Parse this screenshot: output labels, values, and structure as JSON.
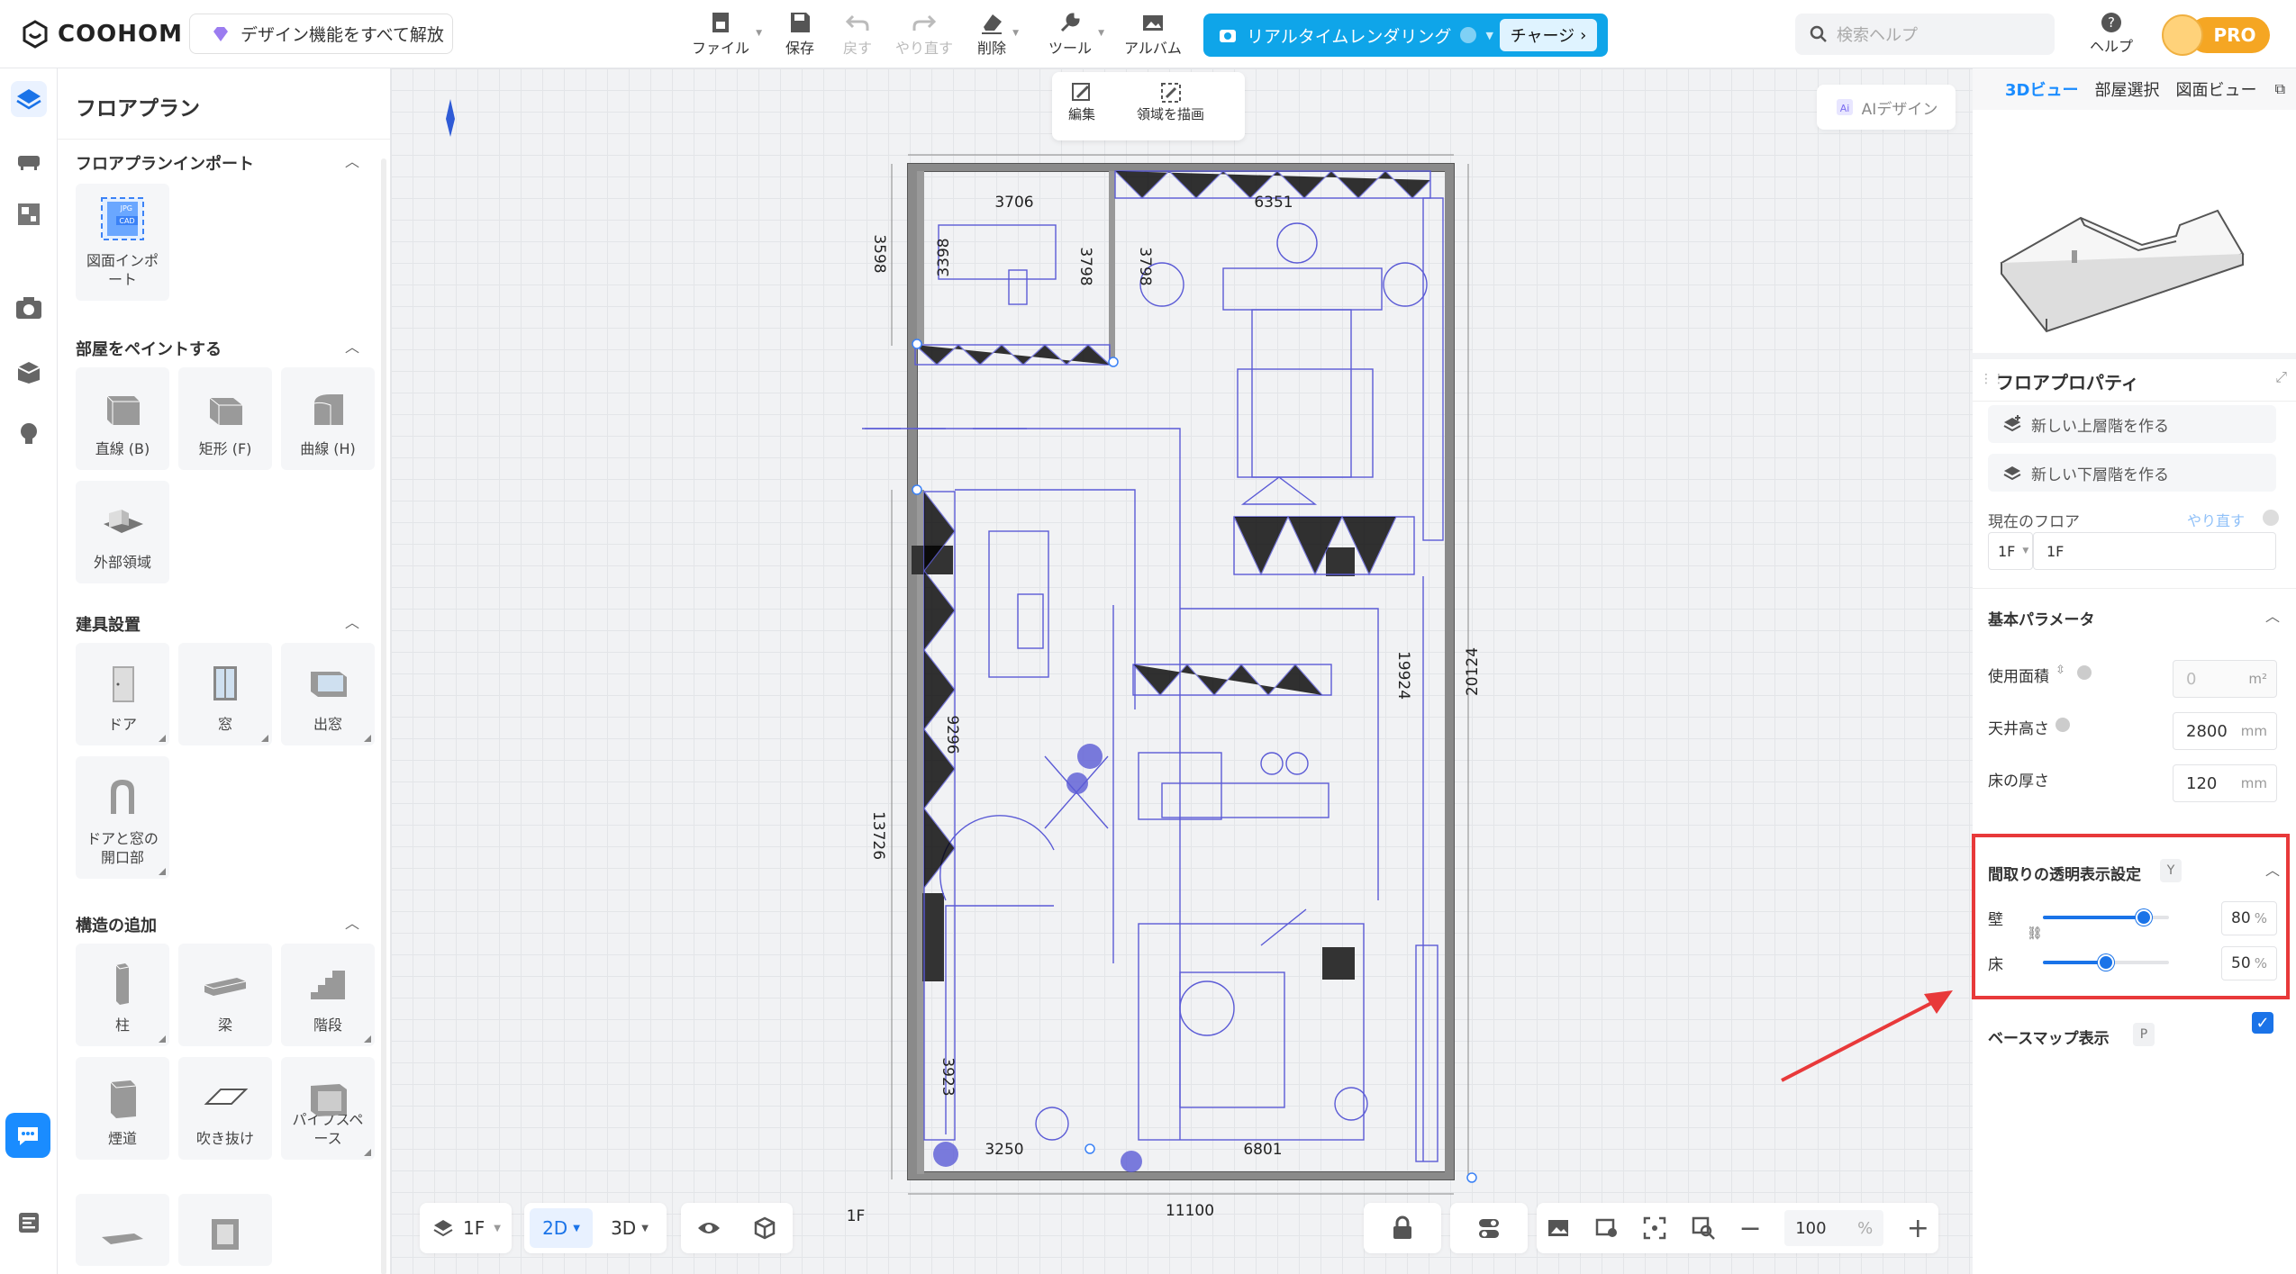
{
  "app": {
    "brand": "COOHOM",
    "unlock_label": "デザイン機能をすべて解放"
  },
  "toolbar": {
    "file": "ファイル",
    "save": "保存",
    "undo": "戻す",
    "redo": "やり直す",
    "delete": "削除",
    "tools": "ツール",
    "album": "アルバム",
    "render_label": "リアルタイムレンダリング",
    "charge_label": "チャージ"
  },
  "search": {
    "placeholder": "検索ヘルプ"
  },
  "help_label": "ヘルプ",
  "pro_label": "PRO",
  "left_panel": {
    "title": "フロアプラン",
    "import_section": "フロアプランインポート",
    "import_item": "図面インポート",
    "import_badge_top": "JPG",
    "import_badge_bottom": "CAD",
    "paint_section": "部屋をペイントする",
    "paint_items": [
      "直線 (B)",
      "矩形 (F)",
      "曲線 (H)",
      "外部領域"
    ],
    "fixture_section": "建具設置",
    "fixture_items": [
      "ドア",
      "窓",
      "出窓",
      "ドアと窓の開口部"
    ],
    "structure_section": "構造の追加",
    "structure_items": [
      "柱",
      "梁",
      "階段",
      "煙道",
      "吹き抜け",
      "パイプスペース"
    ]
  },
  "float_toolbar": {
    "edit": "編集",
    "draw_area": "領域を描画"
  },
  "ai_design": "AIデザイン",
  "plan": {
    "dims": [
      "3706",
      "6351",
      "3598",
      "3398",
      "3798",
      "3798",
      "19924",
      "20124",
      "9296",
      "13726",
      "3923",
      "3250",
      "6801",
      "11100"
    ],
    "floor_mark": "1F"
  },
  "bottom": {
    "floor": "1F",
    "mode_2d": "2D",
    "mode_3d": "3D",
    "zoom": "100",
    "zoom_unit": "%"
  },
  "right_panel": {
    "tabs": [
      "3Dビュー",
      "部屋選択",
      "図面ビュー"
    ],
    "props_title": "フロアプロパティ",
    "new_upper": "新しい上層階を作る",
    "new_lower": "新しい下層階を作る",
    "current_floor_label": "現在のフロア",
    "redo_link": "やり直す",
    "floor_select": "1F",
    "floor_name": "1F",
    "basic_params": "基本パラメータ",
    "area_label": "使用面積",
    "area_value": "0",
    "area_unit": "m²",
    "ceiling_label": "天井高さ",
    "ceiling_value": "2800",
    "ceiling_unit": "mm",
    "floor_thick_label": "床の厚さ",
    "floor_thick_value": "120",
    "floor_thick_unit": "mm",
    "transparency_title": "間取りの透明表示設定",
    "transparency_key": "Y",
    "wall_label": "壁",
    "wall_value": "80",
    "floor_label": "床",
    "floor_value": "50",
    "pct": "%",
    "basemap_label": "ベースマップ表示",
    "basemap_key": "P",
    "basemap_checked": true
  },
  "colors": {
    "accent": "#1a73e8",
    "render": "#0fa5e9",
    "pro": "#f5a623",
    "highlight": "#e8393a",
    "plan_line": "#5b5bd6"
  }
}
